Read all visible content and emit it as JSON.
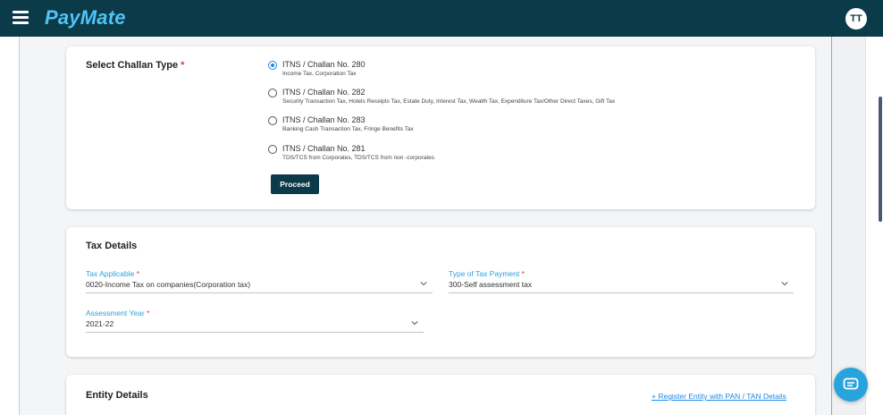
{
  "app": {
    "logo": "PayMate",
    "avatar_initials": "TT"
  },
  "challan": {
    "label": "Select Challan Type",
    "required_mark": "*",
    "options": [
      {
        "title": "ITNS / Challan No. 280",
        "subtitle": "Income Tax, Corporation Tax",
        "selected": true
      },
      {
        "title": "ITNS / Challan No. 282",
        "subtitle": "Security Transaction Tax, Hotels Receipts Tax, Estate Duty, Interest Tax, Wealth Tax, Expenditure Tax/Other Direct Taxes, Gift Tax",
        "selected": false
      },
      {
        "title": "ITNS / Challan No. 283",
        "subtitle": "Banking Cash Transaction Tax, Fringe Benefits Tax",
        "selected": false
      },
      {
        "title": "ITNS / Challan No. 281",
        "subtitle": "TDS/TCS from Corporates, TDS/TCS from non -corporates",
        "selected": false
      }
    ],
    "proceed_label": "Proceed"
  },
  "tax_details": {
    "heading": "Tax Details",
    "tax_applicable": {
      "label": "Tax Applicable",
      "required_mark": "*",
      "value": "0020-Income Tax on companies(Corporation tax)"
    },
    "type_of_payment": {
      "label": "Type of Tax Payment",
      "required_mark": "*",
      "value": "300-Self assessment tax"
    },
    "assessment_year": {
      "label": "Assessment Year",
      "required_mark": "*",
      "value": "2021-22"
    }
  },
  "entity": {
    "heading": "Entity Details",
    "register_link": "+ Register Entity with PAN / TAN Details"
  },
  "colors": {
    "topbar": "#0b3a48",
    "logo": "#4fc3f7",
    "accent": "#29a3dd",
    "link": "#1e88e5",
    "required": "#e53935"
  },
  "icons": [
    "menu-icon",
    "chevron-down-icon",
    "chat-icon"
  ]
}
